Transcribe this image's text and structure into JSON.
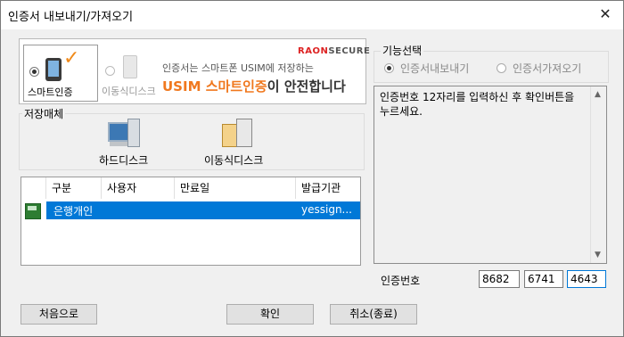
{
  "window": {
    "title": "인증서 내보내기/가져오기",
    "close_glyph": "✕"
  },
  "banner": {
    "smart_label": "스마트인증",
    "removable_label": "이동식디스크",
    "brand": "RAON",
    "brand_secure": "SECURE",
    "line1": "인증서는 스마트폰 USIM에 저장하는",
    "line2_orange": "USIM 스마트인증",
    "line2_rest": "이 안전합니다"
  },
  "storage": {
    "group_label": "저장매체",
    "hard_disk": "하드디스크",
    "removable_disk": "이동식디스크"
  },
  "cert_list": {
    "headers": [
      "구분",
      "사용자",
      "만료일",
      "발급기관"
    ],
    "rows": [
      {
        "type": "은행개인",
        "user": "",
        "expires": "",
        "issuer": "yessign..."
      }
    ]
  },
  "function": {
    "group_label": "기능선택",
    "export": "인증서내보내기",
    "import": "인증서가져오기"
  },
  "message": "인증번호 12자리를 입력하신 후 확인버튼을 누르세요.",
  "auth": {
    "label": "인증번호",
    "field1": "8682",
    "field2": "6741",
    "field3": "4643"
  },
  "buttons": {
    "first": "처음으로",
    "ok": "확인",
    "cancel": "취소(종료)"
  },
  "colors": {
    "selection": "#0078d7",
    "accent_orange": "#f0781e",
    "brand_red": "#dd2222"
  }
}
